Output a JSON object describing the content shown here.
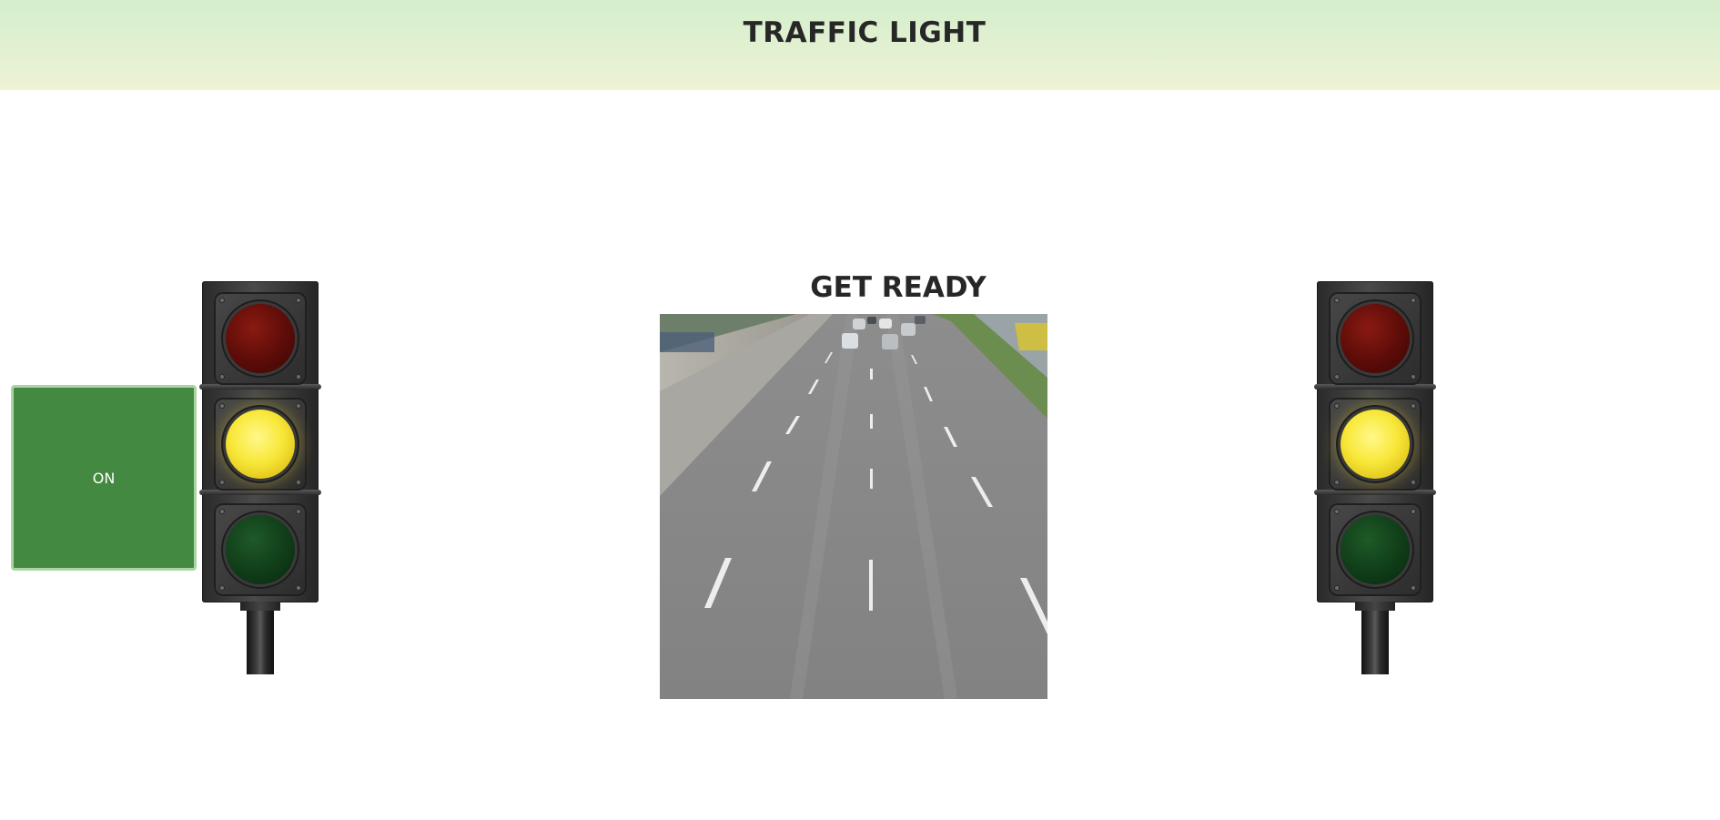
{
  "header": {
    "title": "TRAFFIC LIGHT"
  },
  "controls": {
    "power_button_label": "ON"
  },
  "status": {
    "message": "GET READY"
  },
  "lights": {
    "left": {
      "red": "off",
      "yellow": "on",
      "green": "off"
    },
    "right": {
      "red": "off",
      "yellow": "on",
      "green": "off"
    }
  },
  "colors": {
    "header_gradient_top": "#d4eecd",
    "header_gradient_bottom": "#eef3d4",
    "button_background": "#438941",
    "button_border": "#a9d4a4",
    "lamp_red": "#5c0c08",
    "lamp_yellow": "#f8e83a",
    "lamp_green": "#103d18"
  }
}
